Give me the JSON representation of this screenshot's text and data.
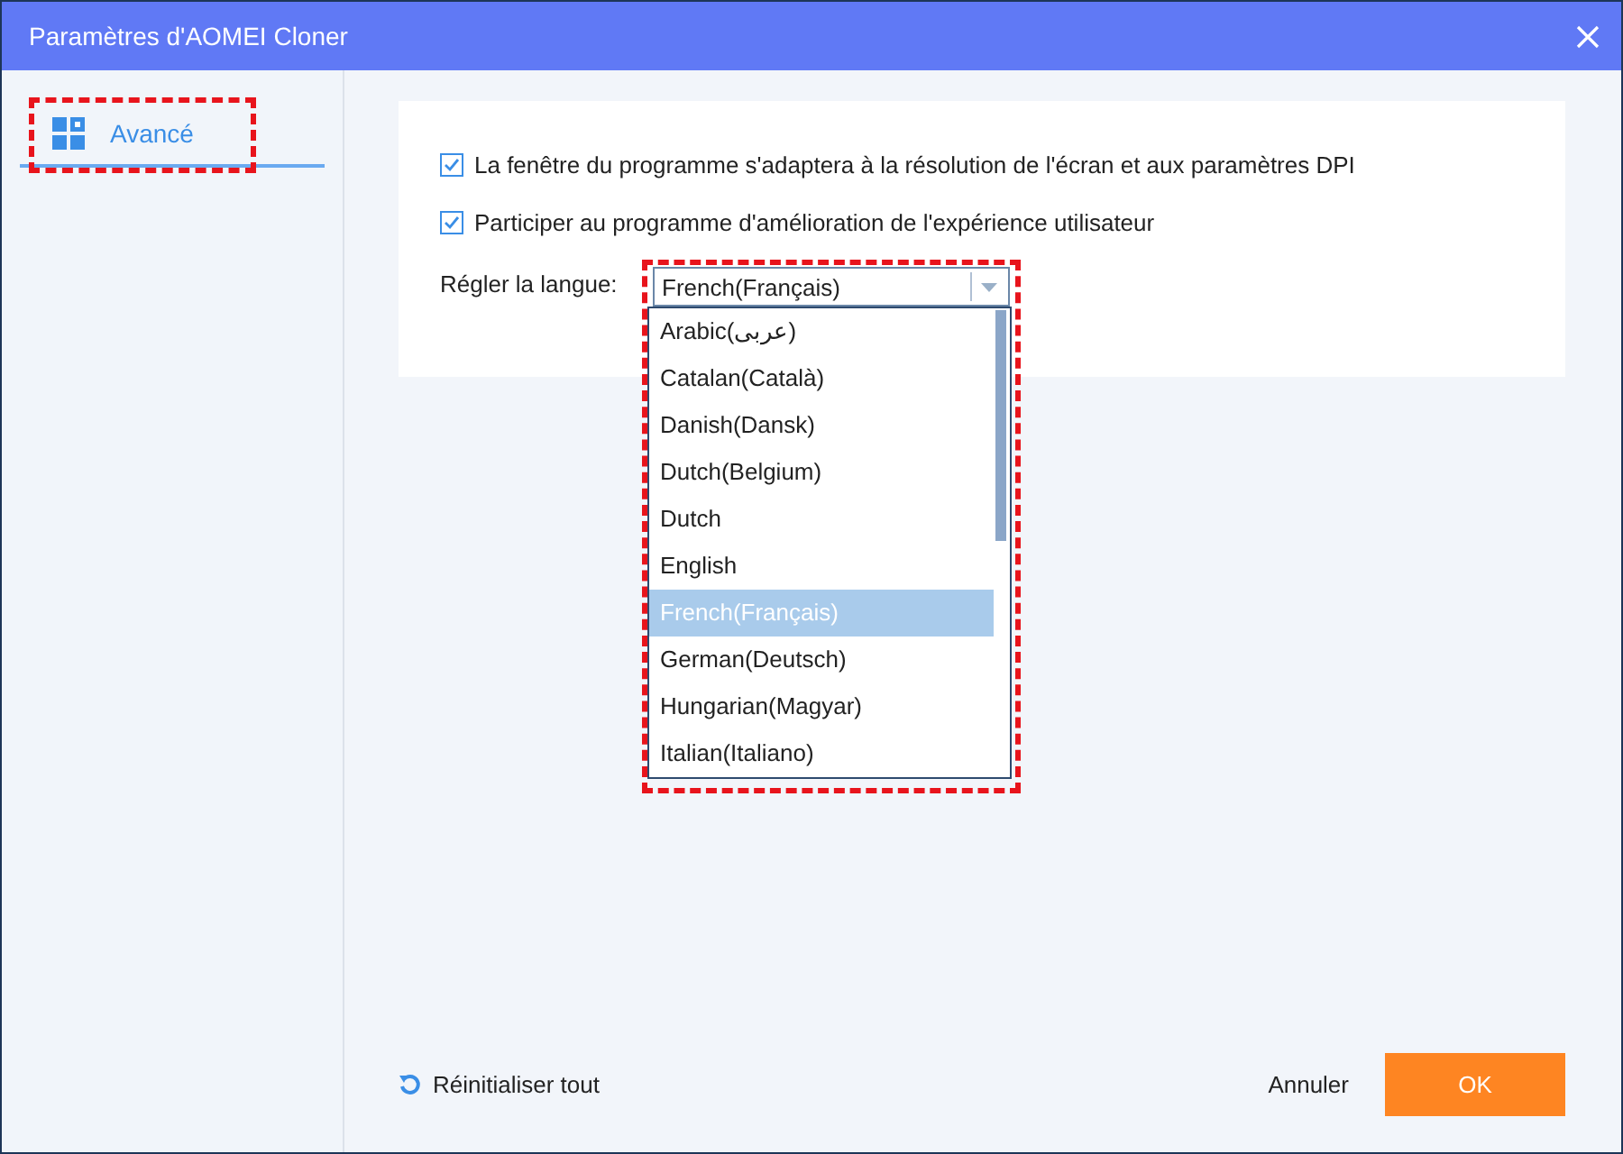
{
  "window": {
    "title": "Paramètres d'AOMEI Cloner"
  },
  "sidebar": {
    "tabs": [
      {
        "label": "Avancé",
        "selected": true,
        "highlighted": true
      }
    ]
  },
  "options": [
    {
      "label": "La fenêtre du programme s'adaptera à la résolution de l'écran et aux paramètres DPI",
      "checked": true
    },
    {
      "label": "Participer au programme d'amélioration de l'expérience utilisateur",
      "checked": true
    }
  ],
  "language": {
    "label": "Régler la langue:",
    "value": "French(Français)",
    "expanded": true,
    "highlighted": true,
    "items": [
      {
        "label": "Arabic(عربى)",
        "selected": false
      },
      {
        "label": "Catalan(Català)",
        "selected": false
      },
      {
        "label": "Danish(Dansk)",
        "selected": false
      },
      {
        "label": "Dutch(Belgium)",
        "selected": false
      },
      {
        "label": "Dutch",
        "selected": false
      },
      {
        "label": "English",
        "selected": false
      },
      {
        "label": "French(Français)",
        "selected": true
      },
      {
        "label": "German(Deutsch)",
        "selected": false
      },
      {
        "label": "Hungarian(Magyar)",
        "selected": false
      },
      {
        "label": "Italian(Italiano)",
        "selected": false
      }
    ]
  },
  "footer": {
    "reset": "Réinitialiser tout",
    "cancel": "Annuler",
    "ok": "OK"
  }
}
